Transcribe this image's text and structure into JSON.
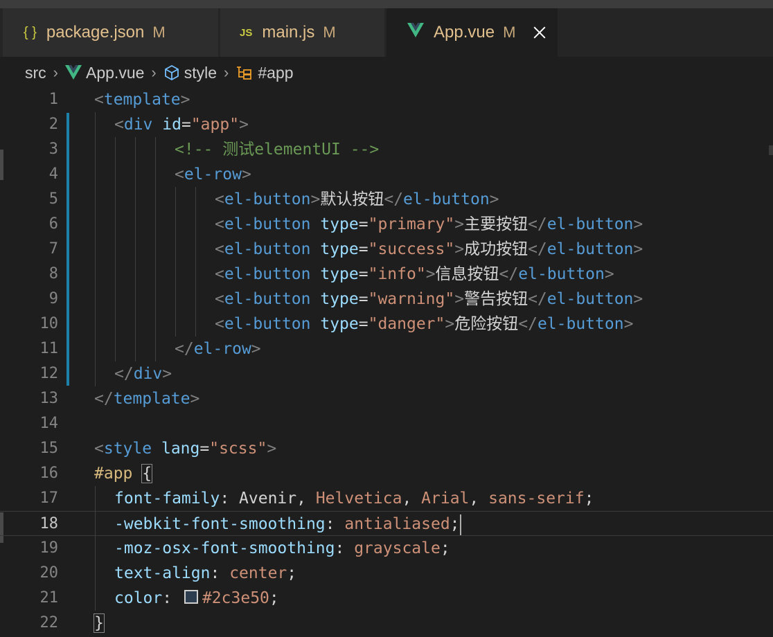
{
  "tabs": [
    {
      "icon": "{ }",
      "name": "package.json",
      "modified": "M"
    },
    {
      "icon": "JS",
      "name": "main.js",
      "modified": "M"
    },
    {
      "icon": "vue-icon",
      "name": "App.vue",
      "modified": "M"
    }
  ],
  "breadcrumb": {
    "folder": "src",
    "file": "App.vue",
    "section": "style",
    "selector": "#app"
  },
  "colors": {
    "tag": "#569cd6",
    "attribute": "#9cdcfe",
    "string": "#ce9178",
    "comment": "#6a9955",
    "selector": "#d7ba7d",
    "swatch": "#2c3e50",
    "modified_gutter": "#1b81a8"
  },
  "editor": {
    "current_line": 18,
    "lines": [
      {
        "n": "1"
      },
      {
        "n": "2"
      },
      {
        "n": "3"
      },
      {
        "n": "4"
      },
      {
        "n": "5"
      },
      {
        "n": "6"
      },
      {
        "n": "7"
      },
      {
        "n": "8"
      },
      {
        "n": "9"
      },
      {
        "n": "10"
      },
      {
        "n": "11"
      },
      {
        "n": "12"
      },
      {
        "n": "13"
      },
      {
        "n": "14"
      },
      {
        "n": "15"
      },
      {
        "n": "16"
      },
      {
        "n": "17"
      },
      {
        "n": "18"
      },
      {
        "n": "19"
      },
      {
        "n": "20"
      },
      {
        "n": "21"
      },
      {
        "n": "22"
      }
    ],
    "code": {
      "l1": {
        "lt": "<",
        "tag": "template",
        "gt": ">"
      },
      "l2": {
        "lt": "<",
        "tag": "div",
        "sp": " ",
        "attr": "id",
        "eq": "=",
        "val": "\"app\"",
        "gt": ">"
      },
      "l3": {
        "comment": "<!-- 测试elementUI -->"
      },
      "l4": {
        "lt": "<",
        "tag": "el-row",
        "gt": ">"
      },
      "l5": {
        "lt": "<",
        "tag": "el-button",
        "gt": ">",
        "text": "默认按钮",
        "clt": "</",
        "ctag": "el-button",
        "cgt": ">"
      },
      "l6": {
        "lt": "<",
        "tag": "el-button",
        "sp": " ",
        "attr": "type",
        "eq": "=",
        "val": "\"primary\"",
        "gt": ">",
        "text": "主要按钮",
        "clt": "</",
        "ctag": "el-button",
        "cgt": ">"
      },
      "l7": {
        "lt": "<",
        "tag": "el-button",
        "sp": " ",
        "attr": "type",
        "eq": "=",
        "val": "\"success\"",
        "gt": ">",
        "text": "成功按钮",
        "clt": "</",
        "ctag": "el-button",
        "cgt": ">"
      },
      "l8": {
        "lt": "<",
        "tag": "el-button",
        "sp": " ",
        "attr": "type",
        "eq": "=",
        "val": "\"info\"",
        "gt": ">",
        "text": "信息按钮",
        "clt": "</",
        "ctag": "el-button",
        "cgt": ">"
      },
      "l9": {
        "lt": "<",
        "tag": "el-button",
        "sp": " ",
        "attr": "type",
        "eq": "=",
        "val": "\"warning\"",
        "gt": ">",
        "text": "警告按钮",
        "clt": "</",
        "ctag": "el-button",
        "cgt": ">"
      },
      "l10": {
        "lt": "<",
        "tag": "el-button",
        "sp": " ",
        "attr": "type",
        "eq": "=",
        "val": "\"danger\"",
        "gt": ">",
        "text": "危险按钮",
        "clt": "</",
        "ctag": "el-button",
        "cgt": ">"
      },
      "l11": {
        "clt": "</",
        "ctag": "el-row",
        "cgt": ">"
      },
      "l12": {
        "clt": "</",
        "ctag": "div",
        "cgt": ">"
      },
      "l13": {
        "clt": "</",
        "ctag": "template",
        "cgt": ">"
      },
      "l15": {
        "lt": "<",
        "tag": "style",
        "sp": " ",
        "attr": "lang",
        "eq": "=",
        "val": "\"scss\"",
        "gt": ">"
      },
      "l16": {
        "sel": "#app",
        "sp": " ",
        "brace": "{"
      },
      "l17": {
        "prop": "font-family",
        "colon": ": ",
        "v1": "Avenir",
        "c1": ", ",
        "v2": "Helvetica",
        "c2": ", ",
        "v3": "Arial",
        "c3": ", ",
        "v4": "sans-serif",
        "semi": ";"
      },
      "l18": {
        "prop": "-webkit-font-smoothing",
        "colon": ": ",
        "v1": "antialiased",
        "semi": ";"
      },
      "l19": {
        "prop": "-moz-osx-font-smoothing",
        "colon": ": ",
        "v1": "grayscale",
        "semi": ";"
      },
      "l20": {
        "prop": "text-align",
        "colon": ": ",
        "v1": "center",
        "semi": ";"
      },
      "l21": {
        "prop": "color",
        "colon": ": ",
        "v1": "#2c3e50",
        "semi": ";"
      },
      "l22": {
        "brace": "}"
      }
    }
  }
}
